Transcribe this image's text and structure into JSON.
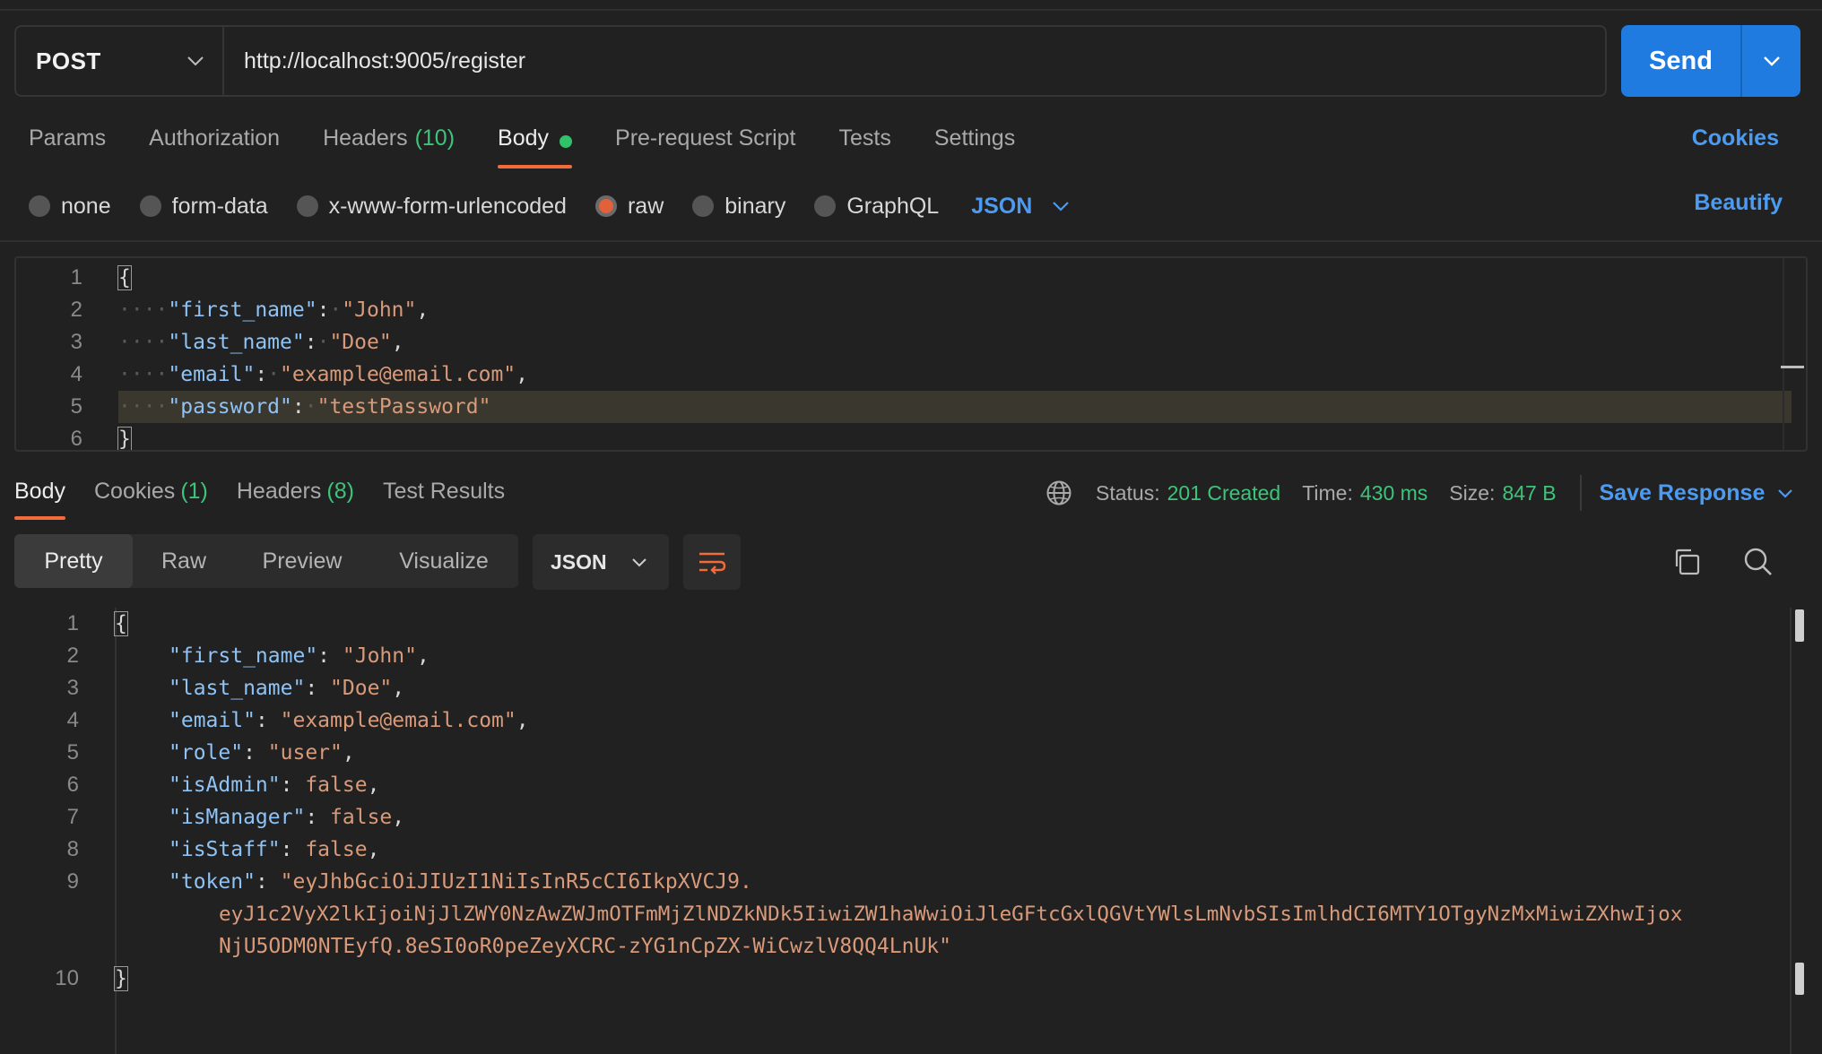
{
  "request": {
    "method": "POST",
    "url": "http://localhost:9005/register",
    "send_label": "Send"
  },
  "request_tabs": [
    {
      "label": "Params",
      "count": ""
    },
    {
      "label": "Authorization",
      "count": ""
    },
    {
      "label": "Headers",
      "count": "(10)"
    },
    {
      "label": "Body",
      "count": ""
    },
    {
      "label": "Pre-request Script",
      "count": ""
    },
    {
      "label": "Tests",
      "count": ""
    },
    {
      "label": "Settings",
      "count": ""
    }
  ],
  "cookies_link": "Cookies",
  "body_types": [
    "none",
    "form-data",
    "x-www-form-urlencoded",
    "raw",
    "binary",
    "GraphQL"
  ],
  "body_format": "JSON",
  "beautify_label": "Beautify",
  "request_body": {
    "line_numbers": [
      "1",
      "2",
      "3",
      "4",
      "5",
      "6"
    ],
    "open_brace": "{",
    "close_brace": "}",
    "fields": [
      {
        "key": "\"first_name\"",
        "value": "\"John\""
      },
      {
        "key": "\"last_name\"",
        "value": "\"Doe\""
      },
      {
        "key": "\"email\"",
        "value": "\"example@email.com\""
      },
      {
        "key": "\"password\"",
        "value": "\"testPassword\""
      }
    ]
  },
  "response_tabs": [
    {
      "label": "Body",
      "count": ""
    },
    {
      "label": "Cookies",
      "count": "(1)"
    },
    {
      "label": "Headers",
      "count": "(8)"
    },
    {
      "label": "Test Results",
      "count": ""
    }
  ],
  "response_status": {
    "status_label": "Status:",
    "status_value": "201 Created",
    "time_label": "Time:",
    "time_value": "430 ms",
    "size_label": "Size:",
    "size_value": "847 B",
    "save_response": "Save Response"
  },
  "view_modes": [
    "Pretty",
    "Raw",
    "Preview",
    "Visualize"
  ],
  "response_format": "JSON",
  "response_body": {
    "line_numbers": [
      "1",
      "2",
      "3",
      "4",
      "5",
      "6",
      "7",
      "8",
      "9",
      "10"
    ],
    "open_brace": "{",
    "close_brace": "}",
    "fields": [
      {
        "key": "\"first_name\"",
        "value": "\"John\""
      },
      {
        "key": "\"last_name\"",
        "value": "\"Doe\""
      },
      {
        "key": "\"email\"",
        "value": "\"example@email.com\""
      },
      {
        "key": "\"role\"",
        "value": "\"user\""
      },
      {
        "key": "\"isAdmin\"",
        "value": "false"
      },
      {
        "key": "\"isManager\"",
        "value": "false"
      },
      {
        "key": "\"isStaff\"",
        "value": "false"
      }
    ],
    "token_key": "\"token\"",
    "token_lines": [
      "\"eyJhbGciOiJIUzI1NiIsInR5cCI6IkpXVCJ9.",
      "eyJ1c2VyX2lkIjoiNjJlZWY0NzAwZWJmOTFmMjZlNDZkNDk5IiwiZW1haWwiOiJleGFtcGxlQGVtYWlsLmNvbSIsImlhdCI6MTY1OTgyNzMxMiwiZXhwIjox",
      "NjU5ODM0NTEyfQ.8eSI0oR0peZeyXCRC-zYG1nCpZX-WiCwzlV8QQ4LnUk\""
    ]
  },
  "colors": {
    "accent_blue": "#1f7be0",
    "link_blue": "#4c9bf0",
    "success_green": "#3ec47a",
    "active_tab_orange": "#f26b3a"
  },
  "icons": [
    "chevron-down-icon",
    "globe-icon",
    "wrap-lines-icon",
    "copy-icon",
    "search-icon"
  ]
}
